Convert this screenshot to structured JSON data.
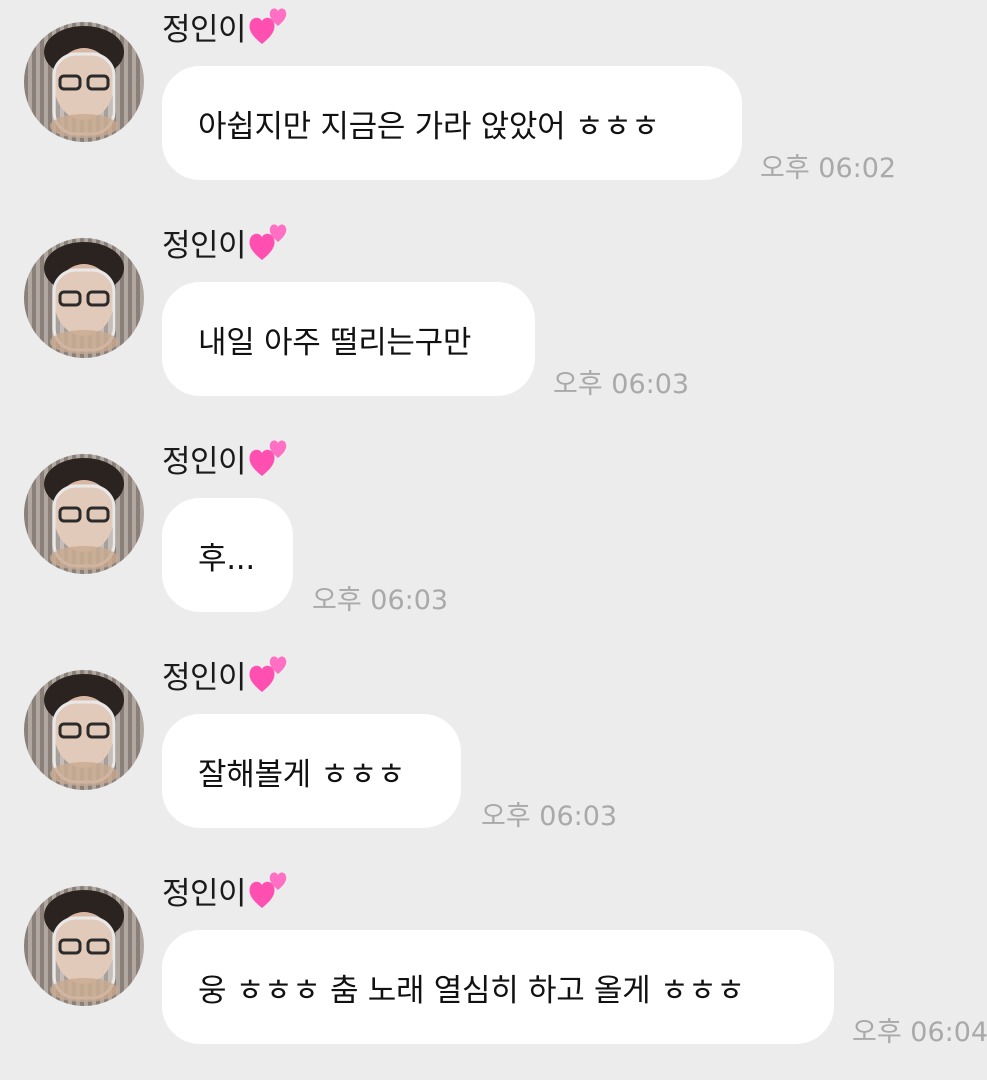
{
  "colors": {
    "background": "#ececec",
    "bubble": "#ffffff",
    "timestamp": "#a9a9a9",
    "heart": "#ff4fb0"
  },
  "messages": [
    {
      "sender": "정인이",
      "sender_icon": "two-hearts-icon",
      "text": "아쉽지만 지금은 가라 앉았어 ㅎㅎㅎ",
      "time": "오후 06:02"
    },
    {
      "sender": "정인이",
      "sender_icon": "two-hearts-icon",
      "text": "내일 아주 떨리는구만",
      "time": "오후 06:03"
    },
    {
      "sender": "정인이",
      "sender_icon": "two-hearts-icon",
      "text": "후...",
      "time": "오후 06:03"
    },
    {
      "sender": "정인이",
      "sender_icon": "two-hearts-icon",
      "text": "잘해볼게 ㅎㅎㅎ",
      "time": "오후 06:03"
    },
    {
      "sender": "정인이",
      "sender_icon": "two-hearts-icon",
      "text": "웅 ㅎㅎㅎ 춤 노래 열심히 하고 올게 ㅎㅎㅎ",
      "time": "오후 06:04"
    }
  ]
}
